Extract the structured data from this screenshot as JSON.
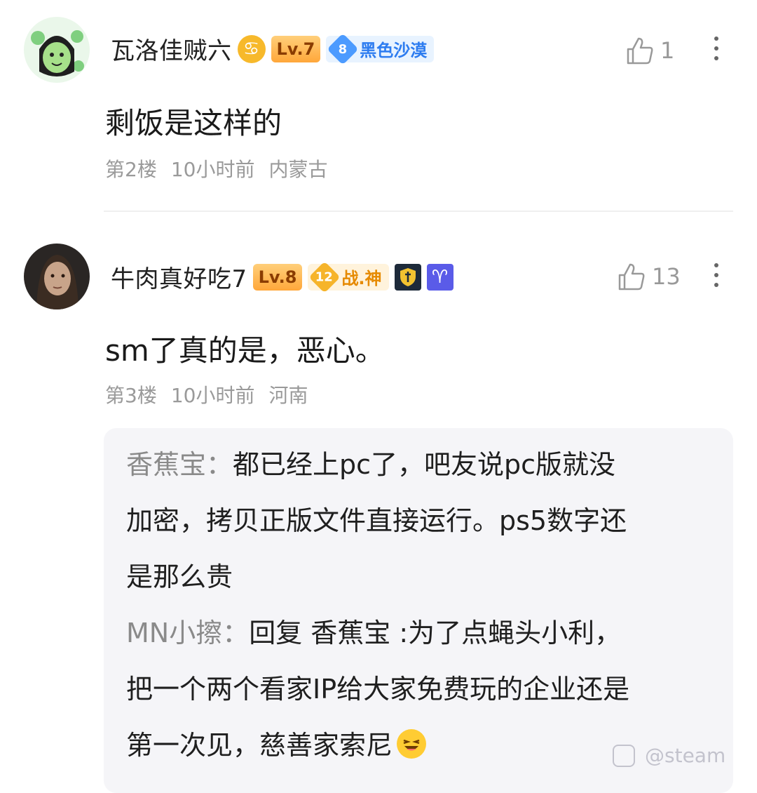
{
  "post1": {
    "username": "瓦洛佳贼六",
    "level": "Lv.7",
    "fan_badge_num": "8",
    "fan_badge_name": "黑色沙漠",
    "like_count": "1",
    "content": "剩饭是这样的",
    "floor": "第2楼",
    "time": "10小时前",
    "location": "内蒙古"
  },
  "post2": {
    "username": "牛肉真好吃7",
    "level": "Lv.8",
    "fan_badge_num": "12",
    "fan_badge_name": "战.神",
    "like_count": "13",
    "content": "sm了真的是，恶心。",
    "floor": "第3楼",
    "time": "10小时前",
    "location": "河南",
    "replies": [
      {
        "name": "香蕉宝：",
        "text_lines": [
          "都已经上pc了，吧友说pc版就没",
          "加密，拷贝正版文件直接运行。ps5数字还",
          "是那么贵"
        ]
      },
      {
        "name": "MN小擦：",
        "text_lines": [
          "回复 香蕉宝 :为了点蝇头小利，",
          "把一个两个看家IP给大家免费玩的企业还是",
          "第一次见，慈善家索尼"
        ]
      }
    ]
  },
  "watermark": "@steam"
}
